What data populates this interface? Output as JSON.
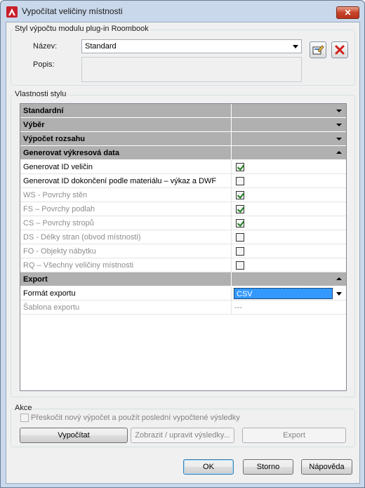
{
  "window": {
    "title": "Vypočítat veličiny místnosti",
    "close_glyph": "✕"
  },
  "style_group": {
    "title": "Styl výpočtu modulu plug-in Roombook",
    "name_label": "Název:",
    "name_value": "Standard",
    "description_label": "Popis:",
    "description_value": ""
  },
  "properties": {
    "title": "Vlastnosti stylu",
    "rows": [
      {
        "type": "category",
        "label": "Standardní",
        "expanded": false
      },
      {
        "type": "category",
        "label": "Výběr",
        "expanded": false
      },
      {
        "type": "category",
        "label": "Výpočet rozsahu",
        "expanded": false
      },
      {
        "type": "category",
        "label": "Generovat výkresová data",
        "expanded": true
      },
      {
        "type": "check",
        "label": "Generovat ID veličin",
        "checked": true,
        "disabled": false
      },
      {
        "type": "check",
        "label": "Generovat ID dokončení podle materiálu – výkaz a DWF",
        "checked": false,
        "disabled": false
      },
      {
        "type": "check",
        "label": "WS - Povrchy stěn",
        "checked": true,
        "disabled": true
      },
      {
        "type": "check",
        "label": "FS – Povrchy podlah",
        "checked": true,
        "disabled": true
      },
      {
        "type": "check",
        "label": "CS – Povrchy stropů",
        "checked": true,
        "disabled": true
      },
      {
        "type": "check",
        "label": "DS - Délky stran (obvod místnosti)",
        "checked": false,
        "disabled": true
      },
      {
        "type": "check",
        "label": "FO - Objekty nábytku",
        "checked": false,
        "disabled": true
      },
      {
        "type": "check",
        "label": "RQ – Všechny veličiny místnosti",
        "checked": false,
        "disabled": true
      },
      {
        "type": "category",
        "label": "Export",
        "expanded": true
      },
      {
        "type": "select",
        "label": "Formát exportu",
        "value": "CSV",
        "disabled": false
      },
      {
        "type": "text",
        "label": "Šablona exportu",
        "value": "---",
        "disabled": true
      }
    ]
  },
  "actions": {
    "title": "Akce",
    "skip_label": "Přeskočit nový výpočet a použít poslední vypočtené výsledky",
    "skip_checked": false,
    "calculate": "Vypočítat",
    "show_results": "Zobrazit / upravit výsledky...",
    "export": "Export"
  },
  "footer": {
    "ok": "OK",
    "cancel": "Storno",
    "help": "Nápověda"
  },
  "colors": {
    "accent": "#3399ff",
    "title_bar": "#c9d8ea",
    "close_button": "#c7442a",
    "category_row": "#b0b0b0"
  }
}
